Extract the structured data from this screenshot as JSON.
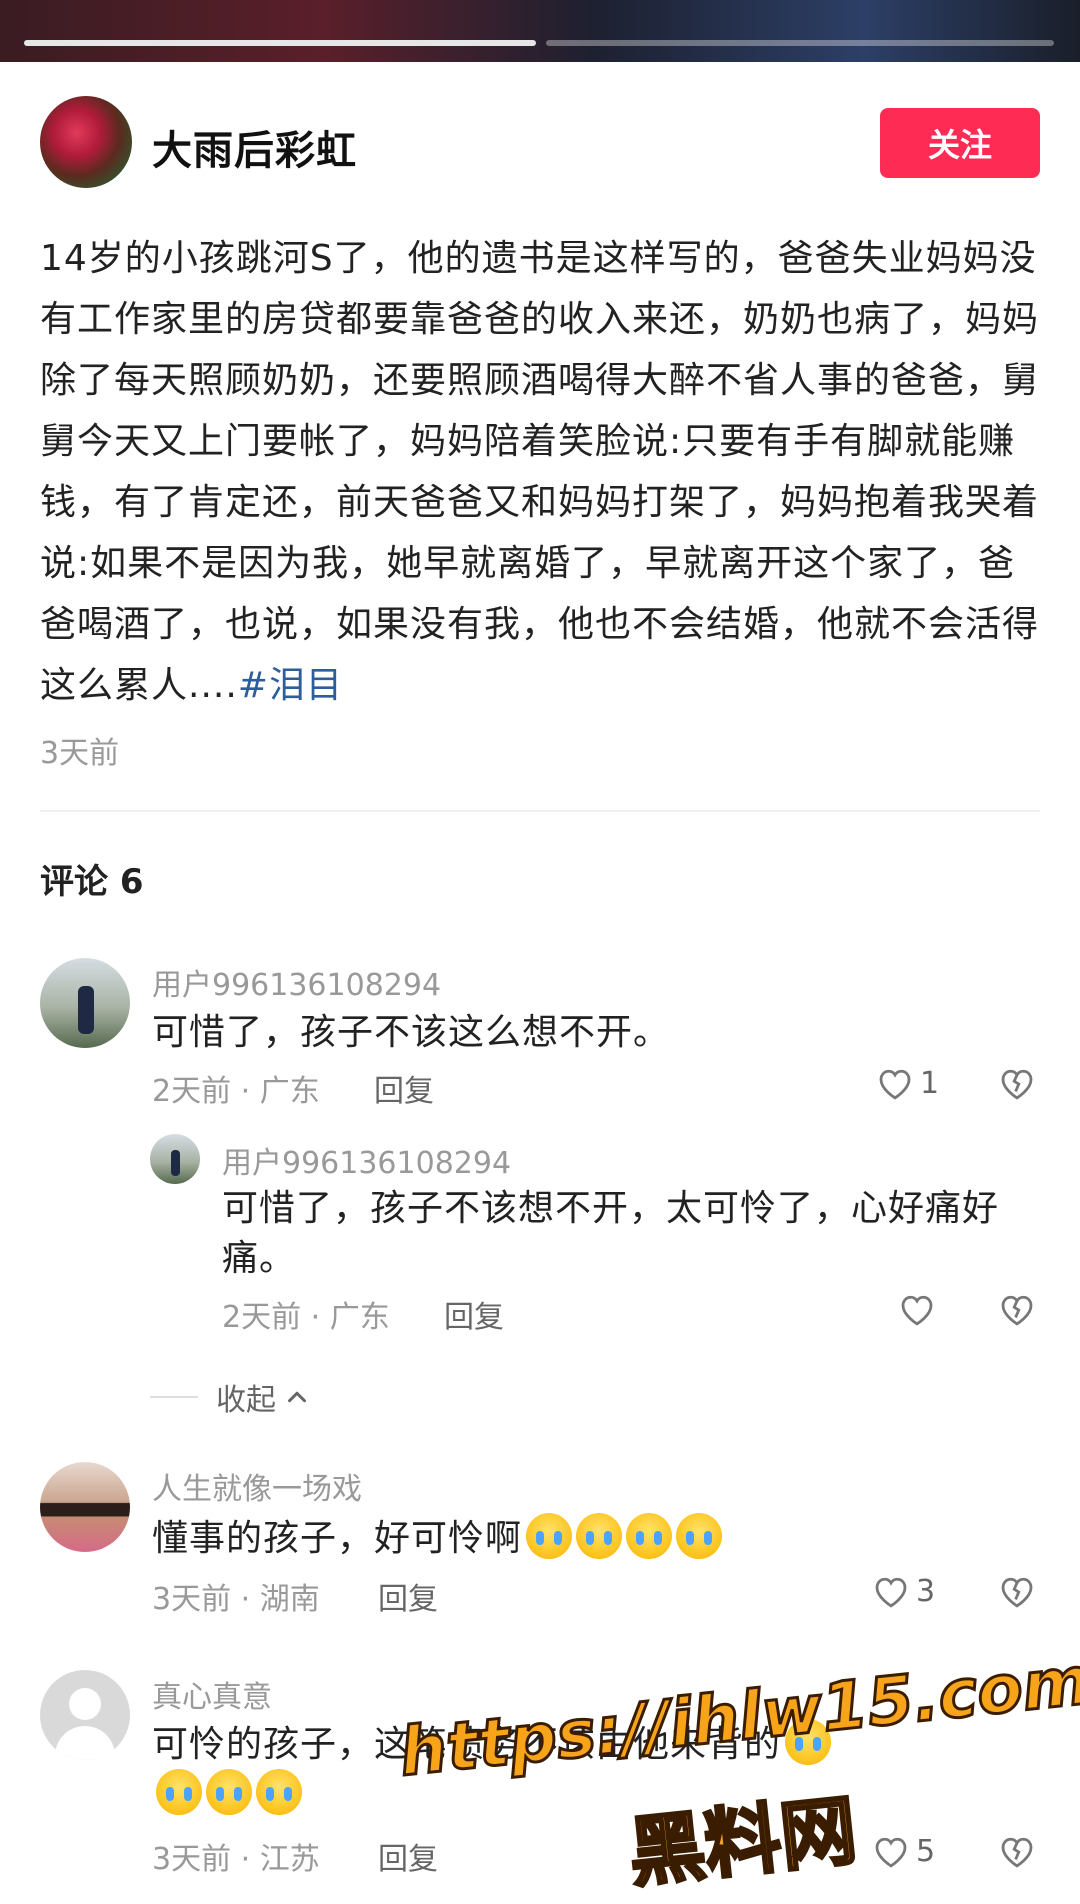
{
  "author": {
    "name": "大雨后彩虹",
    "follow_label": "关注"
  },
  "post": {
    "text": "14岁的小孩跳河S了，他的遗书是这样写的，爸爸失业妈妈没有工作家里的房贷都要靠爸爸的收入来还，奶奶也病了，妈妈除了每天照顾奶奶，还要照顾酒喝得大醉不省人事的爸爸，舅舅今天又上门要帐了，妈妈陪着笑脸说:只要有手有脚就能赚钱，有了肯定还，前天爸爸又和妈妈打架了，妈妈抱着我哭着说:如果不是因为我，她早就离婚了，早就离开这个家了，爸爸喝酒了，也说，如果没有我，他也不会结婚，他就不会活得这么累人....",
    "hashtag": "#泪目",
    "time": "3天前"
  },
  "comments_heading": "评论 6",
  "comments": [
    {
      "user": "用户996136108294",
      "text": "可惜了，孩子不该这么想不开。",
      "meta": "2天前 · 广东",
      "reply": "回复",
      "likes": "1"
    },
    {
      "user": "用户996136108294",
      "text": "可惜了，孩子不该想不开，太可怜了，心好痛好痛。",
      "meta": "2天前 · 广东",
      "reply": "回复",
      "likes": ""
    },
    {
      "user": "人生就像一场戏",
      "text": "懂事的孩子，好可怜啊",
      "meta": "3天前 · 湖南",
      "reply": "回复",
      "likes": "3"
    },
    {
      "user": "真心真意",
      "text": "可怜的孩子，这笔债务不该由他来背的",
      "meta": "3天前 · 江苏",
      "reply": "回复",
      "likes": "5"
    }
  ],
  "collapse_label": "收起",
  "watermark": {
    "url": "https://ihlw15.com",
    "name": "黑料网"
  },
  "icons": {
    "like": "heart-outline-icon",
    "dislike": "broken-heart-icon",
    "collapse": "chevron-up-icon",
    "emoji": "crying-face-emoji"
  },
  "colors": {
    "accent": "#fe2c55",
    "hashtag": "#2d5d9a",
    "muted": "#999999",
    "watermark": "#f7a41a"
  }
}
